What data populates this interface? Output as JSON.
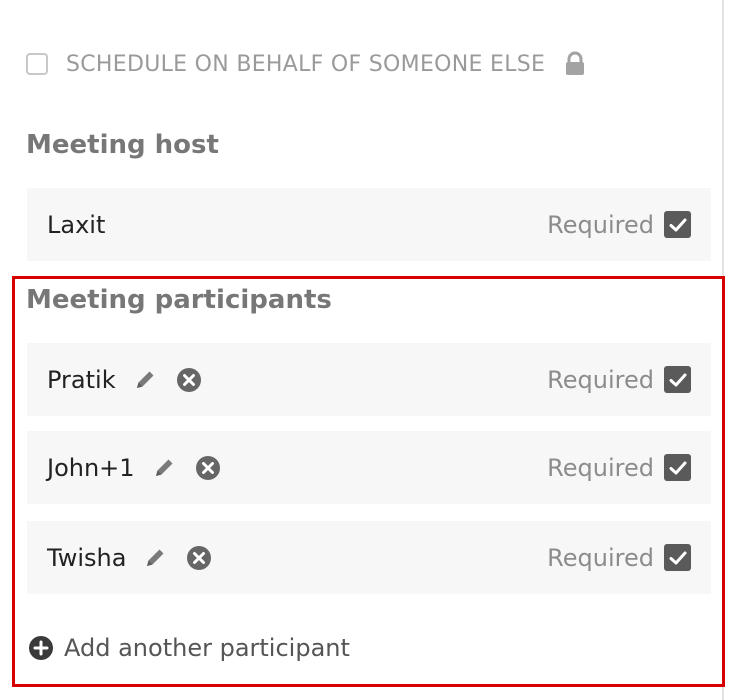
{
  "schedule_on_behalf": {
    "label": "SCHEDULE ON BEHALF OF SOMEONE ELSE",
    "checked": false,
    "icon": "lock-icon"
  },
  "host": {
    "title": "Meeting host",
    "name": "Laxit",
    "required_label": "Required",
    "required_checked": true
  },
  "participants": {
    "title": "Meeting participants",
    "items": [
      {
        "name": "Pratik",
        "required_label": "Required",
        "required_checked": true
      },
      {
        "name": "John+1",
        "required_label": "Required",
        "required_checked": true
      },
      {
        "name": "Twisha",
        "required_label": "Required",
        "required_checked": true
      }
    ],
    "add_label": "Add another participant"
  },
  "colors": {
    "highlight_border": "#d60000",
    "checkbox_fill": "#5a5a5a",
    "row_background": "#f7f7f7"
  }
}
